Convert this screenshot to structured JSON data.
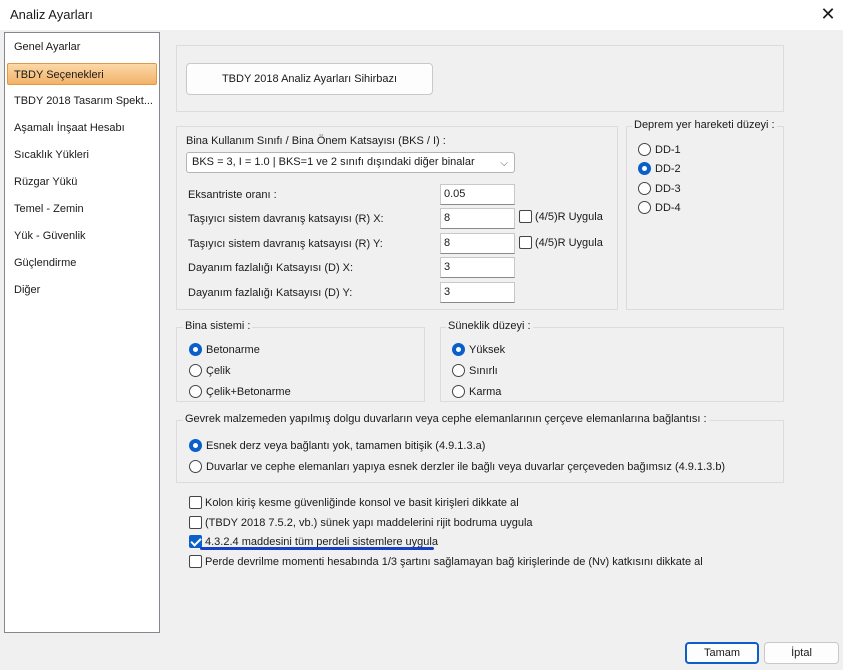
{
  "window": {
    "title": "Analiz Ayarları",
    "close_glyph": "✕"
  },
  "sidebar": {
    "items": [
      {
        "label": "Genel Ayarlar"
      },
      {
        "label": "TBDY Seçenekleri",
        "selected": true
      },
      {
        "label": "TBDY 2018 Tasarım Spekt..."
      },
      {
        "label": "Aşamalı İnşaat Hesabı"
      },
      {
        "label": "Sıcaklık Yükleri"
      },
      {
        "label": "Rüzgar Yükü"
      },
      {
        "label": "Temel - Zemin"
      },
      {
        "label": "Yük - Güvenlik"
      },
      {
        "label": "Güçlendirme"
      },
      {
        "label": "Diğer"
      }
    ]
  },
  "wizard": {
    "label": "TBDY 2018 Analiz Ayarları Sihirbazı"
  },
  "building_class": {
    "label": "Bina Kullanım Sınıfı / Bina Önem Katsayısı (BKS / I) :",
    "selected": "BKS = 3, I = 1.0 | BKS=1 ve 2 sınıfı dışındaki diğer binalar",
    "arrow": "⌵"
  },
  "fields": {
    "eccentricity": {
      "label": "Eksantriste oranı :",
      "value": "0.05"
    },
    "rx": {
      "label": "Taşıyıcı sistem davranış katsayısı (R) X:",
      "value": "8",
      "check_label": "(4/5)R Uygula"
    },
    "ry": {
      "label": "Taşıyıcı sistem davranış katsayısı (R) Y:",
      "value": "8",
      "check_label": "(4/5)R Uygula"
    },
    "dx": {
      "label": "Dayanım fazlalığı Katsayısı (D) X:",
      "value": "3"
    },
    "dy": {
      "label": "Dayanım fazlalığı Katsayısı (D) Y:",
      "value": "3"
    }
  },
  "earthquake_level": {
    "label": "Deprem yer hareketi düzeyi :",
    "options": [
      {
        "label": "DD-1",
        "selected": false
      },
      {
        "label": "DD-2",
        "selected": true
      },
      {
        "label": "DD-3",
        "selected": false
      },
      {
        "label": "DD-4",
        "selected": false
      }
    ]
  },
  "building_system": {
    "label": "Bina sistemi :",
    "options": [
      {
        "label": "Betonarme",
        "selected": true
      },
      {
        "label": "Çelik",
        "selected": false
      },
      {
        "label": "Çelik+Betonarme",
        "selected": false
      }
    ]
  },
  "ductility": {
    "label": "Süneklik düzeyi :",
    "options": [
      {
        "label": "Yüksek",
        "selected": true
      },
      {
        "label": "Sınırlı",
        "selected": false
      },
      {
        "label": "Karma",
        "selected": false
      }
    ]
  },
  "infill_walls": {
    "label": "Gevrek malzemeden yapılmış dolgu duvarların veya cephe elemanlarının çerçeve elemanlarına bağlantısı :",
    "options": [
      {
        "label": "Esnek derz veya bağlantı yok, tamamen bitişik (4.9.1.3.a)",
        "selected": true
      },
      {
        "label": "Duvarlar ve cephe elemanları yapıya esnek derzler ile bağlı veya duvarlar çerçeveden bağımsız (4.9.1.3.b)",
        "selected": false
      }
    ]
  },
  "checks": [
    {
      "label": "Kolon kiriş kesme güvenliğinde konsol ve basit kirişleri dikkate al",
      "checked": false
    },
    {
      "label": "(TBDY 2018 7.5.2, vb.) sünek yapı maddelerini rijit bodruma uygula",
      "checked": false
    },
    {
      "label": "4.3.2.4 maddesini tüm perdeli sistemlere uygula",
      "checked": true
    },
    {
      "label": "Perde devrilme momenti hesabında 1/3 şartını sağlamayan bağ kirişlerinde de (Nv) katkısını dikkate al",
      "checked": false
    }
  ],
  "footer": {
    "ok": "Tamam",
    "cancel": "İptal"
  },
  "colors": {
    "accent": "#0b5fc9",
    "selected_item": "#f3b26a",
    "highlight_underline": "#1540c8"
  }
}
